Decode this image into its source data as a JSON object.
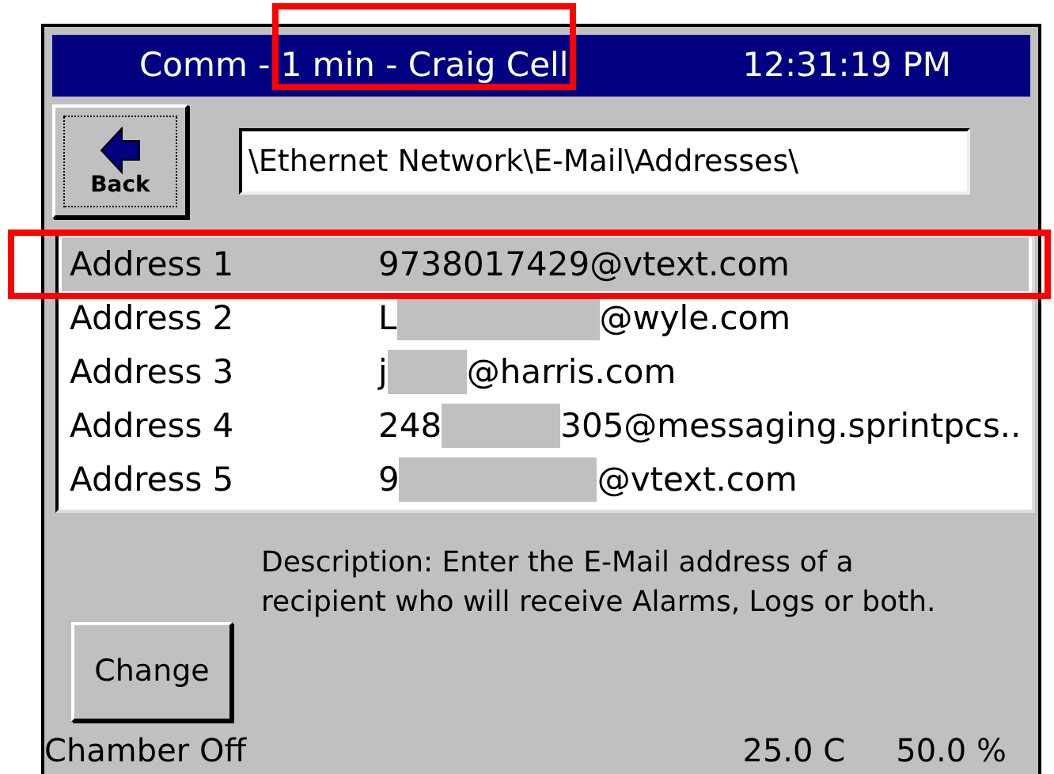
{
  "title_bar": {
    "parts": [
      {
        "text": "Comm - ",
        "circled": false
      },
      {
        "text": "1 min - Craig Cell",
        "circled": true
      }
    ],
    "clock": "12:31:19 PM"
  },
  "back_button": {
    "label": "Back"
  },
  "path_field": {
    "value": "\\Ethernet Network\\E-Mail\\Addresses\\"
  },
  "addresses": [
    {
      "name": "Address 1",
      "prefix": "9738017429@vtext.com",
      "redacted": false,
      "selected": true,
      "circled": true
    },
    {
      "name": "Address 2",
      "prefix": "L",
      "redacted": true,
      "suffix": "@wyle.com",
      "selected": false,
      "circled": false
    },
    {
      "name": "Address 3",
      "prefix": "j",
      "redacted": true,
      "suffix": "@harris.com",
      "selected": false,
      "circled": false
    },
    {
      "name": "Address 4",
      "prefix": "248",
      "redacted": true,
      "suffix": "305@messaging.sprintpcs..",
      "selected": false,
      "circled": false
    },
    {
      "name": "Address 5",
      "prefix": "9",
      "redacted": true,
      "suffix": "@vtext.com",
      "selected": false,
      "circled": false
    }
  ],
  "description": "Description:  Enter the E-Mail address of a recipient who will receive Alarms, Logs or both.",
  "change_button": {
    "label": "Change"
  },
  "status_bar": {
    "state": "Chamber Off",
    "temperature": "25.0 C",
    "humidity": "50.0 %"
  }
}
